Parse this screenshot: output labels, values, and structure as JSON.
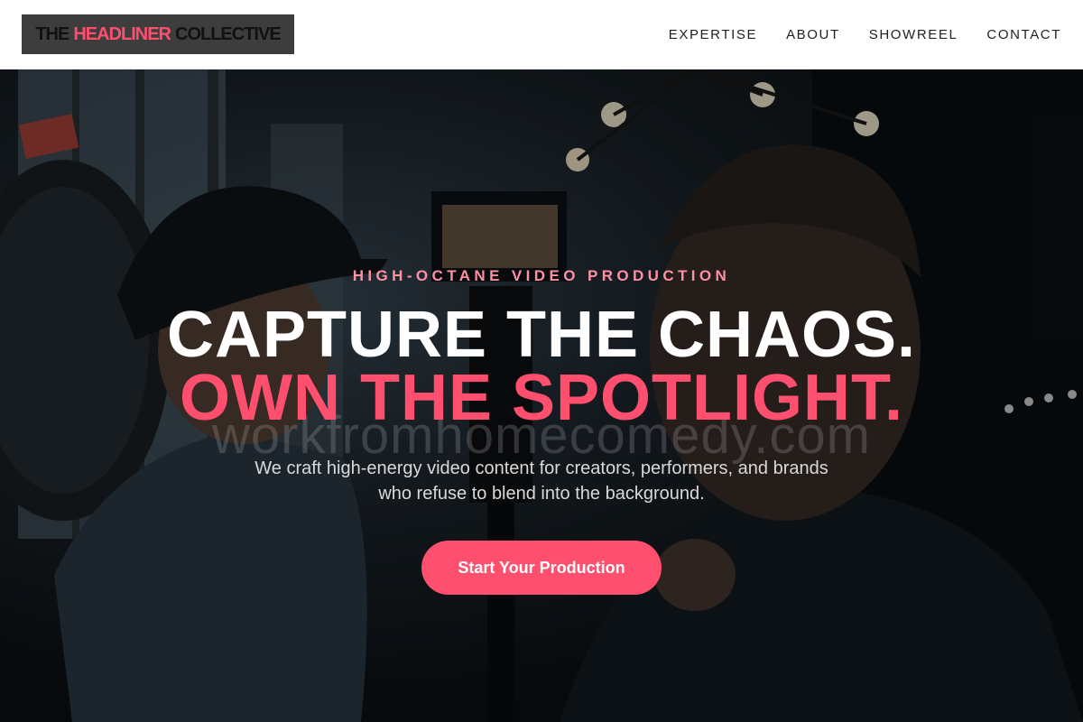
{
  "brand": {
    "part1": "THE",
    "part2": "HEADLINER",
    "part3": "COLLECTIVE",
    "accent_color": "#ff4f6e"
  },
  "nav": {
    "items": [
      {
        "label": "EXPERTISE"
      },
      {
        "label": "ABOUT"
      },
      {
        "label": "SHOWREEL"
      },
      {
        "label": "CONTACT"
      }
    ]
  },
  "hero": {
    "eyebrow": "HIGH-OCTANE VIDEO PRODUCTION",
    "headline_line1": "CAPTURE THE CHAOS.",
    "headline_line2": "OWN THE SPOTLIGHT.",
    "watermark": "workfromhomecomedy.com",
    "subtext": "We craft high-energy video content for creators, performers, and brands who refuse to blend into the background.",
    "cta_label": "Start Your Production",
    "background_image": "film-crew-camera-photo",
    "cta_color": "#ff4f6e"
  }
}
